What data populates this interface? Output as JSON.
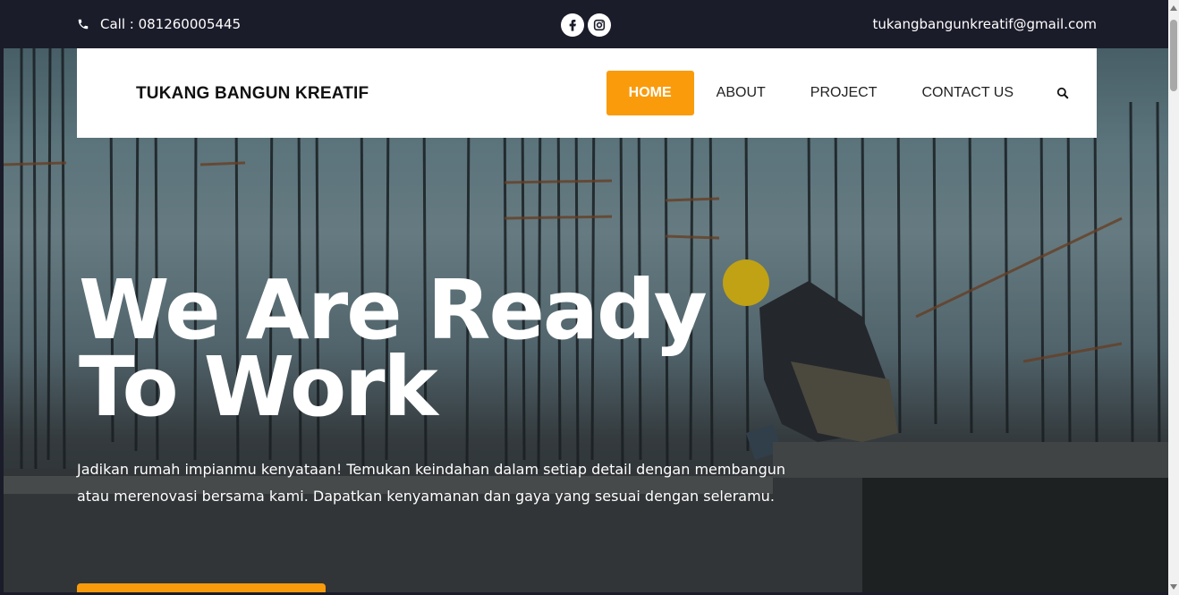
{
  "topbar": {
    "phone_icon": "phone-icon",
    "phone_text": "Call : 081260005445",
    "social_icons": [
      "facebook-icon",
      "instagram-icon"
    ],
    "email": "tukangbangunkreatif@gmail.com"
  },
  "nav": {
    "brand": "TUKANG BANGUN KREATIF",
    "items": [
      {
        "label": "HOME",
        "active": true
      },
      {
        "label": "ABOUT",
        "active": false
      },
      {
        "label": "PROJECT",
        "active": false
      },
      {
        "label": "CONTACT US",
        "active": false
      }
    ],
    "search_icon": "search-icon"
  },
  "hero": {
    "headline_line1": "We Are Ready",
    "headline_line2": "To Work",
    "subtitle": "Jadikan rumah impianmu kenyataan! Temukan keindahan dalam setiap detail dengan membangun atau merenovasi bersama kami. Dapatkan kenyamanan dan gaya yang sesuai dengan seleramu."
  },
  "colors": {
    "accent": "#fa9b0c",
    "topbar_bg": "#1b1c2a",
    "nav_bg": "#ffffff"
  }
}
